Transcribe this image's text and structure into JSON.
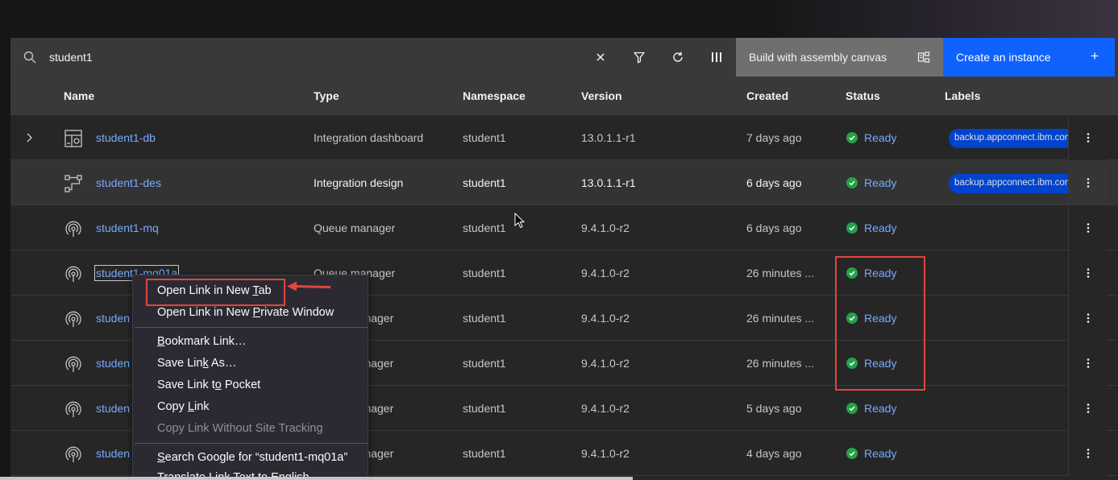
{
  "search": {
    "value": "student1",
    "placeholder": ""
  },
  "toolbar": {
    "assembly_label": "Build with assembly canvas",
    "create_label": "Create an instance"
  },
  "columns": [
    "Name",
    "Type",
    "Namespace",
    "Version",
    "Created",
    "Status",
    "Labels"
  ],
  "rows": [
    {
      "name": "student1-db",
      "type": "Integration dashboard",
      "namespace": "student1",
      "version": "13.0.1.1-r1",
      "created": "7 days ago",
      "status": "Ready",
      "label": "backup.appconnect.ibm.com",
      "icon": "dashboard-icon",
      "expandable": true
    },
    {
      "name": "student1-des",
      "type": "Integration design",
      "namespace": "student1",
      "version": "13.0.1.1-r1",
      "created": "6 days ago",
      "status": "Ready",
      "label": "backup.appconnect.ibm.com",
      "icon": "flow-icon"
    },
    {
      "name": "student1-mq",
      "type": "Queue manager",
      "namespace": "student1",
      "version": "9.4.1.0-r2",
      "created": "6 days ago",
      "status": "Ready",
      "icon": "queue-manager-icon"
    },
    {
      "name": "student1-mq01a",
      "type": "Queue manager",
      "namespace": "student1",
      "version": "9.4.1.0-r2",
      "created": "26 minutes ...",
      "status": "Ready",
      "icon": "queue-manager-icon"
    },
    {
      "name": "studen",
      "type": "manager",
      "namespace": "student1",
      "version": "9.4.1.0-r2",
      "created": "26 minutes ...",
      "status": "Ready",
      "icon": "queue-manager-icon"
    },
    {
      "name": "studen",
      "type": "manager",
      "namespace": "student1",
      "version": "9.4.1.0-r2",
      "created": "26 minutes ...",
      "status": "Ready",
      "icon": "queue-manager-icon"
    },
    {
      "name": "studen",
      "type": "manager",
      "namespace": "student1",
      "version": "9.4.1.0-r2",
      "created": "5 days ago",
      "status": "Ready",
      "icon": "queue-manager-icon"
    },
    {
      "name": "studen",
      "type": "manager",
      "namespace": "student1",
      "version": "9.4.1.0-r2",
      "created": "4 days ago",
      "status": "Ready",
      "icon": "queue-manager-icon"
    }
  ],
  "context_menu": {
    "open_new_tab": [
      "Open Link in New ",
      "T",
      "ab"
    ],
    "open_private": [
      "Open Link in New ",
      "P",
      "rivate Window"
    ],
    "bookmark": [
      "",
      "B",
      "ookmark Link…"
    ],
    "save_as": [
      "Save Lin",
      "k",
      " As…"
    ],
    "save_pocket": [
      "Save Link t",
      "o",
      " Pocket"
    ],
    "copy_link": [
      "Copy ",
      "L",
      "ink"
    ],
    "copy_no_tracking": "Copy Link Without Site Tracking",
    "search_google": [
      "",
      "S",
      "earch Google for “student1-mq01a”"
    ],
    "translate": [
      "T",
      "r",
      "anslate Link Text to English"
    ]
  },
  "colors": {
    "accent": "#0f62fe",
    "link": "#78a9ff",
    "ready": "#24a148",
    "annotation": "#e0463c"
  }
}
